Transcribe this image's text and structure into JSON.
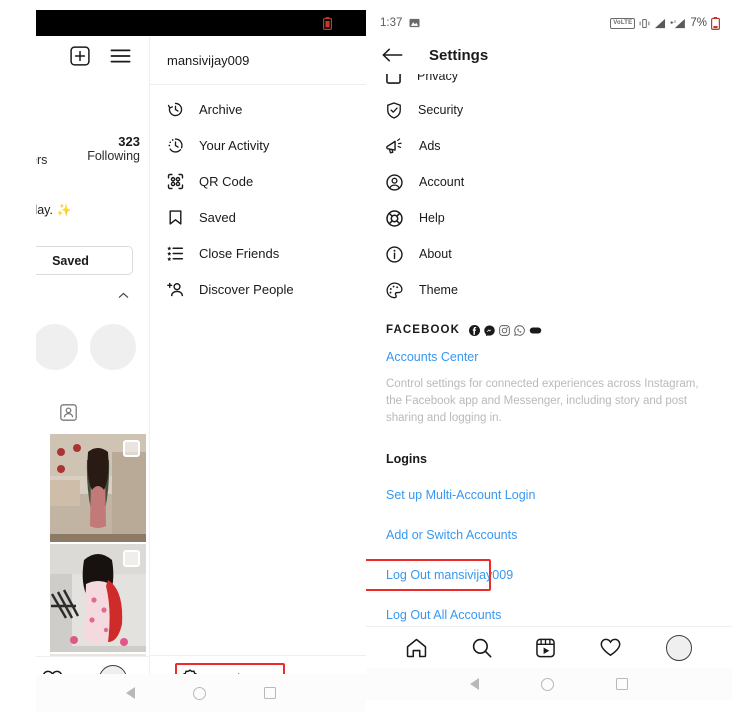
{
  "left_phone": {
    "status_bar": {
      "battery_icon": "battery-low-icon"
    },
    "header": {
      "add_icon": "plus-square-icon",
      "menu_icon": "hamburger-menu-icon"
    },
    "profile": {
      "following_count": "323",
      "following_label": "Following",
      "followers_label_partial": "ers",
      "bio_partial": "yday.",
      "bio_sparkle": "✨",
      "saved_button": "Saved",
      "collapse_icon": "chevron-up-icon",
      "tagged_icon": "tagged-person-icon"
    },
    "tabbar": [
      {
        "name": "activity-tab",
        "icon": "heart-icon"
      },
      {
        "name": "profile-tab",
        "icon": "avatar-circle-icon"
      }
    ],
    "menu": {
      "username": "mansivijay009",
      "items": [
        {
          "label": "Archive",
          "icon": "archive-clock-icon"
        },
        {
          "label": "Your Activity",
          "icon": "your-activity-clock-icon"
        },
        {
          "label": "QR Code",
          "icon": "qr-code-icon"
        },
        {
          "label": "Saved",
          "icon": "bookmark-icon"
        },
        {
          "label": "Close Friends",
          "icon": "close-friends-list-icon"
        },
        {
          "label": "Discover People",
          "icon": "discover-people-icon"
        }
      ],
      "settings_label": "Settings",
      "settings_icon": "gear-icon",
      "highlight_color": "#ee2b2b"
    },
    "system_nav": [
      "back-triangle-icon",
      "home-circle-icon",
      "recents-square-icon"
    ]
  },
  "right_phone": {
    "status_bar": {
      "time": "1:37",
      "image_icon": "photo-icon",
      "volte_badge": "VoLTE",
      "vibrate_icon": "vibrate-icon",
      "signal1_icon": "signal-bars-icon",
      "signal2_icon": "signal-bars-icon",
      "battery_percent": "7%",
      "battery_icon": "battery-low-icon"
    },
    "header": {
      "back_icon": "back-arrow-icon",
      "title": "Settings"
    },
    "settings_items": [
      {
        "label": "Privacy",
        "icon": "privacy-square-icon"
      },
      {
        "label": "Security",
        "icon": "shield-check-icon"
      },
      {
        "label": "Ads",
        "icon": "megaphone-icon"
      },
      {
        "label": "Account",
        "icon": "account-circle-icon"
      },
      {
        "label": "Help",
        "icon": "help-lifebuoy-icon"
      },
      {
        "label": "About",
        "icon": "info-circle-icon"
      },
      {
        "label": "Theme",
        "icon": "palette-icon"
      }
    ],
    "facebook_section": {
      "heading": "FACEBOOK",
      "brand_icons": [
        "facebook-icon",
        "messenger-icon",
        "instagram-icon",
        "whatsapp-icon",
        "oculus-icon"
      ],
      "accounts_center_link": "Accounts Center",
      "description": "Control settings for connected experiences across Instagram, the Facebook app and Messenger, including story and post sharing and logging in."
    },
    "logins_section": {
      "heading": "Logins",
      "links": [
        "Set up Multi-Account Login",
        "Add or Switch Accounts",
        "Log Out mansivijay009",
        "Log Out All Accounts"
      ],
      "highlighted_link": "Log Out mansivijay009",
      "highlight_color": "#ee2b2b",
      "link_color": "#3897f0"
    },
    "tabbar": [
      {
        "name": "home-tab",
        "icon": "home-icon"
      },
      {
        "name": "search-tab",
        "icon": "search-icon"
      },
      {
        "name": "reels-tab",
        "icon": "reels-icon"
      },
      {
        "name": "activity-tab",
        "icon": "heart-icon"
      },
      {
        "name": "profile-tab",
        "icon": "avatar-circle-icon"
      }
    ],
    "system_nav": [
      "back-triangle-icon",
      "home-circle-icon",
      "recents-square-icon"
    ]
  }
}
